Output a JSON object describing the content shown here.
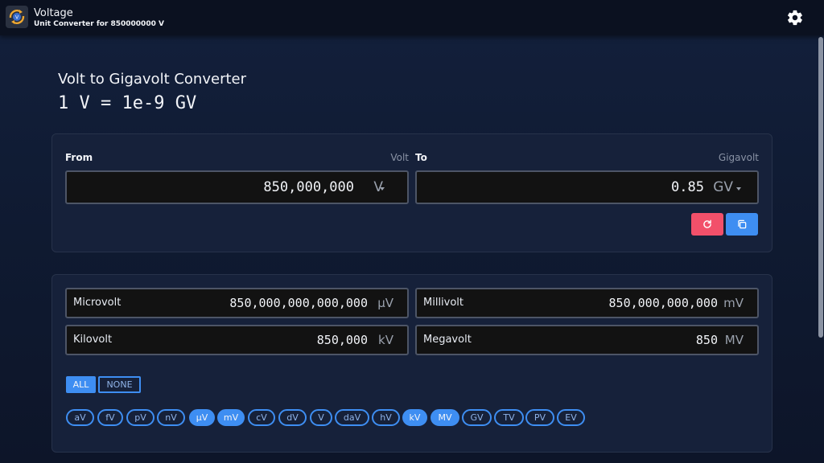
{
  "app": {
    "title": "Voltage",
    "subtitle": "Unit Converter for 850000000 V"
  },
  "heading": "Volt to Gigavolt Converter",
  "formula": "1 V = 1e-9 GV",
  "converter": {
    "from_label": "From",
    "from_unit_name": "Volt",
    "from_value": "850,000,000",
    "from_symbol": "V",
    "to_label": "To",
    "to_unit_name": "Gigavolt",
    "to_value": "0.85",
    "to_symbol": "GV"
  },
  "results": [
    {
      "name": "Microvolt",
      "value": "850,000,000,000,000",
      "symbol": "µV"
    },
    {
      "name": "Millivolt",
      "value": "850,000,000,000",
      "symbol": "mV"
    },
    {
      "name": "Kilovolt",
      "value": "850,000",
      "symbol": "kV"
    },
    {
      "name": "Megavolt",
      "value": "850",
      "symbol": "MV"
    }
  ],
  "select": {
    "all": "ALL",
    "none": "NONE"
  },
  "chips": [
    {
      "label": "aV",
      "selected": false
    },
    {
      "label": "fV",
      "selected": false
    },
    {
      "label": "pV",
      "selected": false
    },
    {
      "label": "nV",
      "selected": false
    },
    {
      "label": "µV",
      "selected": true
    },
    {
      "label": "mV",
      "selected": true
    },
    {
      "label": "cV",
      "selected": false
    },
    {
      "label": "dV",
      "selected": false
    },
    {
      "label": "V",
      "selected": false
    },
    {
      "label": "daV",
      "selected": false
    },
    {
      "label": "hV",
      "selected": false
    },
    {
      "label": "kV",
      "selected": true
    },
    {
      "label": "MV",
      "selected": true
    },
    {
      "label": "GV",
      "selected": false
    },
    {
      "label": "TV",
      "selected": false
    },
    {
      "label": "PV",
      "selected": false
    },
    {
      "label": "EV",
      "selected": false
    }
  ],
  "icons": {
    "app": "voltage-app-icon",
    "settings": "gear-icon",
    "reset": "refresh-icon",
    "copy": "copy-icon"
  },
  "colors": {
    "accent": "#3e8ef2",
    "danger": "#f2506a"
  }
}
